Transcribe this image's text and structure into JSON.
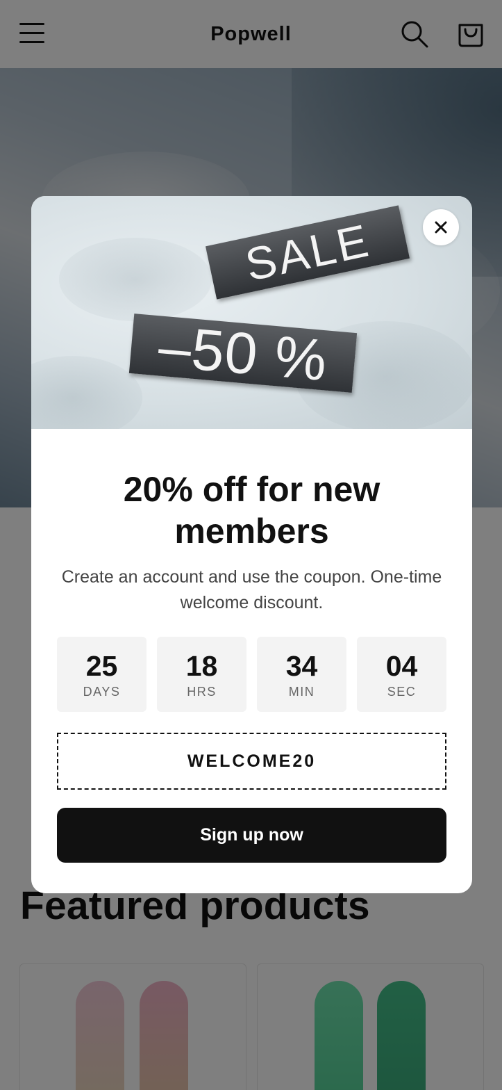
{
  "header": {
    "logo": "Popwell",
    "menu_icon": "hamburger-menu-icon",
    "search_icon": "search-icon",
    "cart_icon": "cart-icon",
    "background": "#ffffff"
  },
  "featured": {
    "title": "Featured products"
  },
  "popup": {
    "image": {
      "sticker_sale": "SALE",
      "sticker_discount": "–50 %"
    },
    "close_icon": "close-icon",
    "title": "20% off for new members",
    "description": "Create an account and use the coupon. One-time welcome discount.",
    "countdown": [
      {
        "value": "25",
        "unit": "DAYS"
      },
      {
        "value": "18",
        "unit": "HRS"
      },
      {
        "value": "34",
        "unit": "MIN"
      },
      {
        "value": "04",
        "unit": "SEC"
      }
    ],
    "coupon_code": "WELCOME20",
    "cta_label": "Sign up now"
  },
  "colors": {
    "primary": "#111111",
    "overlay": "rgba(0,0,0,0.5)",
    "countdown_bg": "#f3f3f3"
  }
}
